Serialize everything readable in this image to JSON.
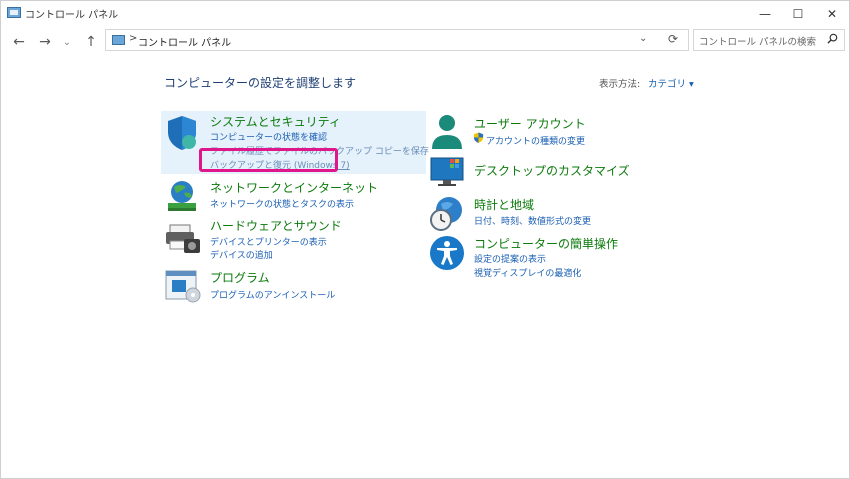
{
  "window": {
    "title": "コントロール パネル",
    "controls": {
      "minimize": "—",
      "maximize": "☐",
      "close": "✕"
    }
  },
  "nav": {
    "back": "←",
    "forward": "→",
    "history": "⌄",
    "up": "↑",
    "breadcrumb_sep": ">",
    "breadcrumb": "コントロール パネル",
    "dropdown": "⌄",
    "refresh": "⟳"
  },
  "search": {
    "placeholder": "コントロール パネルの検索"
  },
  "content": {
    "heading": "コンピューターの設定を調整します",
    "view_by_label": "表示方法:",
    "view_by_value": "カテゴリ ▾"
  },
  "categories_left": [
    {
      "icon": "shield-icon",
      "title": "システムとセキュリティ",
      "links": [
        "コンピューターの状態を確認",
        "ファイル履歴でファイルのバックアップ コピーを保存",
        "バックアップと復元 (Windows 7)"
      ]
    },
    {
      "icon": "network-icon",
      "title": "ネットワークとインターネット",
      "links": [
        "ネットワークの状態とタスクの表示"
      ]
    },
    {
      "icon": "printer-icon",
      "title": "ハードウェアとサウンド",
      "links": [
        "デバイスとプリンターの表示",
        "デバイスの追加"
      ]
    },
    {
      "icon": "programs-icon",
      "title": "プログラム",
      "links": [
        "プログラムのアンインストール"
      ]
    }
  ],
  "categories_right": [
    {
      "icon": "user-icon",
      "title": "ユーザー アカウント",
      "links": [
        "アカウントの種類の変更"
      ]
    },
    {
      "icon": "desktop-icon",
      "title": "デスクトップのカスタマイズ",
      "links": []
    },
    {
      "icon": "clock-globe-icon",
      "title": "時計と地域",
      "links": [
        "日付、時刻、数値形式の変更"
      ]
    },
    {
      "icon": "accessibility-icon",
      "title": "コンピューターの簡単操作",
      "links": [
        "設定の提案の表示",
        "視覚ディスプレイの最適化"
      ]
    }
  ],
  "colors": {
    "category_title": "#0b7a0b",
    "link": "#1a5fb4",
    "highlight_bg": "#e5f1fb",
    "annotation_border": "#e0168c"
  }
}
